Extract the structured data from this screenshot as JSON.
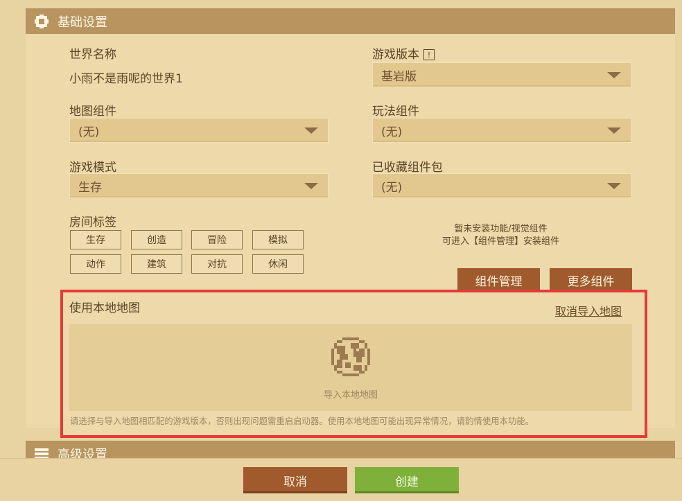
{
  "sections": {
    "basic": {
      "title": "基础设置",
      "icon": "gear-icon"
    },
    "advanced": {
      "title": "高级设置",
      "icon": "list-icon"
    }
  },
  "world_name": {
    "label": "世界名称",
    "value": "小雨不是雨呢的世界1"
  },
  "game_version": {
    "label": "游戏版本",
    "info_badge": "!",
    "selected": "基岩版"
  },
  "map_component": {
    "label": "地图组件",
    "selected": "(无)"
  },
  "gameplay_component": {
    "label": "玩法组件",
    "selected": "(无)"
  },
  "game_mode": {
    "label": "游戏模式",
    "selected": "生存"
  },
  "favorite_pack": {
    "label": "已收藏组件包",
    "selected": "(无)"
  },
  "room_tags": {
    "label": "房间标签",
    "tags": [
      "生存",
      "创造",
      "冒险",
      "模拟",
      "动作",
      "建筑",
      "对抗",
      "休闲"
    ]
  },
  "component_hint": {
    "line1": "暂未安装功能/视觉组件",
    "line2": "可进入【组件管理】安装组件"
  },
  "buttons": {
    "manage_components": "组件管理",
    "more_components": "更多组件",
    "cancel": "取消",
    "create": "创建"
  },
  "local_map": {
    "title": "使用本地地图",
    "cancel_import": "取消导入地图",
    "import_label": "导入本地地图",
    "import_icon": "globe-icon",
    "notice": "请选择与导入地图相匹配的游戏版本，否则出现问题需重启启动器。使用本地地图可能出现异常情况，请酌情使用本功能。"
  },
  "colors": {
    "highlight": "#e53a3a",
    "brown_button": "#a05a2c",
    "green_button": "#7fb03a",
    "section_bar": "#b8945f"
  }
}
